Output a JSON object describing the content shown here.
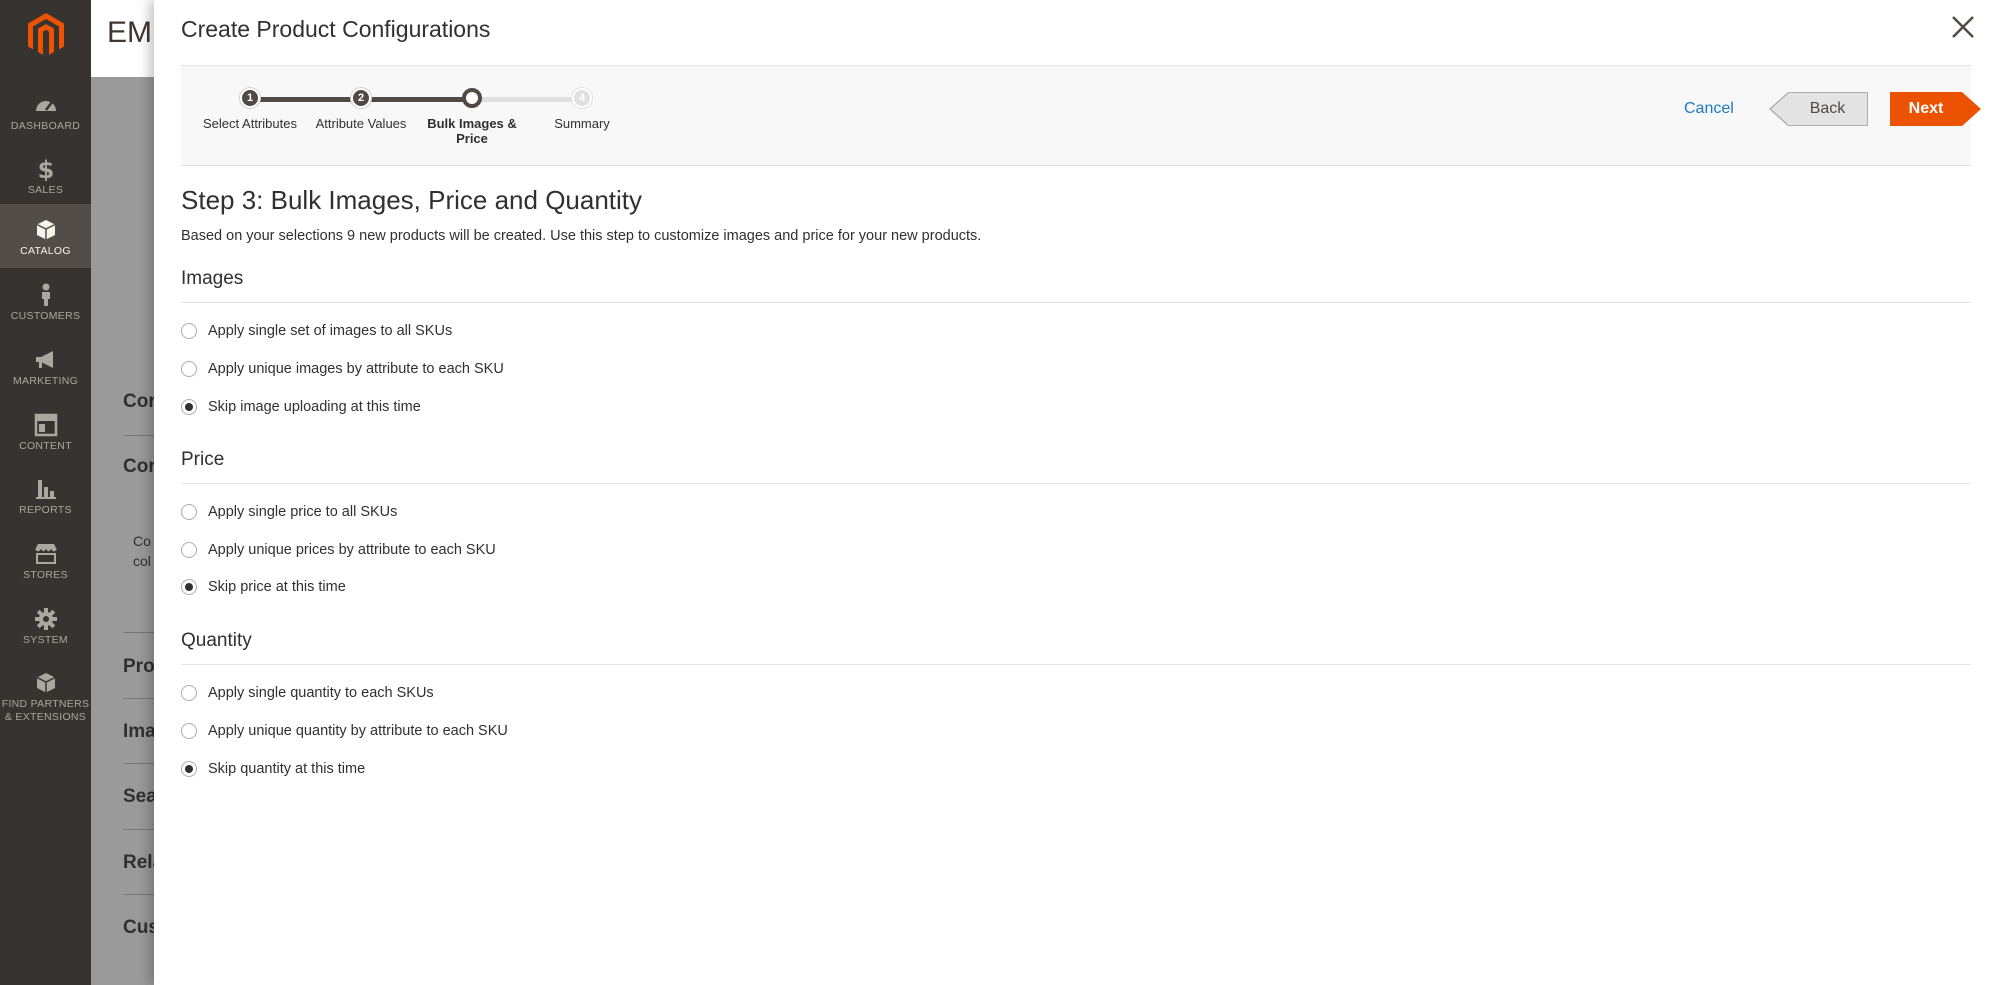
{
  "sidebar": {
    "items": [
      {
        "label": "DASHBOARD",
        "icon": "dashboard-icon"
      },
      {
        "label": "SALES",
        "icon": "dollar-icon"
      },
      {
        "label": "CATALOG",
        "icon": "box-icon"
      },
      {
        "label": "CUSTOMERS",
        "icon": "person-icon"
      },
      {
        "label": "MARKETING",
        "icon": "megaphone-icon"
      },
      {
        "label": "CONTENT",
        "icon": "layout-icon"
      },
      {
        "label": "REPORTS",
        "icon": "bar-chart-icon"
      },
      {
        "label": "STORES",
        "icon": "storefront-icon"
      },
      {
        "label": "SYSTEM",
        "icon": "gear-icon"
      },
      {
        "label": "FIND PARTNERS & EXTENSIONS",
        "icon": "cube-icon"
      }
    ],
    "active": "CATALOG",
    "colors": {
      "bg": "#373330",
      "active": "#524d49",
      "logo": "#eb5202"
    }
  },
  "background_page": {
    "title": "EMI",
    "sections": [
      "Cor",
      "Cor",
      "Pro",
      "Ima",
      "Sea",
      "Rela",
      "Cus"
    ],
    "snippet": [
      "Co",
      "col"
    ]
  },
  "modal": {
    "title": "Create Product Configurations",
    "close_icon": "close-icon",
    "wizard": {
      "steps": [
        {
          "num": "1",
          "label": "Select Attributes",
          "state": "done"
        },
        {
          "num": "2",
          "label": "Attribute Values",
          "state": "done"
        },
        {
          "num": "",
          "label": "Bulk Images & Price",
          "state": "current"
        },
        {
          "num": "4",
          "label": "Summary",
          "state": "todo"
        }
      ],
      "cancel_label": "Cancel",
      "back_label": "Back",
      "next_label": "Next"
    },
    "heading": "Step 3: Bulk Images, Price and Quantity",
    "description": "Based on your selections 9 new products will be created. Use this step to customize images and price for your new products.",
    "sections": [
      {
        "title": "Images",
        "options": [
          {
            "label": "Apply single set of images to all SKUs",
            "checked": false
          },
          {
            "label": "Apply unique images by attribute to each SKU",
            "checked": false
          },
          {
            "label": "Skip image uploading at this time",
            "checked": true
          }
        ]
      },
      {
        "title": "Price",
        "options": [
          {
            "label": "Apply single price to all SKUs",
            "checked": false
          },
          {
            "label": "Apply unique prices by attribute to each SKU",
            "checked": false
          },
          {
            "label": "Skip price at this time",
            "checked": true
          }
        ]
      },
      {
        "title": "Quantity",
        "options": [
          {
            "label": "Apply single quantity to each SKUs",
            "checked": false
          },
          {
            "label": "Apply unique quantity by attribute to each SKU",
            "checked": false
          },
          {
            "label": "Skip quantity at this time",
            "checked": true
          }
        ]
      }
    ],
    "colors": {
      "accent": "#eb5202",
      "link": "#1979c3",
      "progress": "#514943"
    }
  }
}
